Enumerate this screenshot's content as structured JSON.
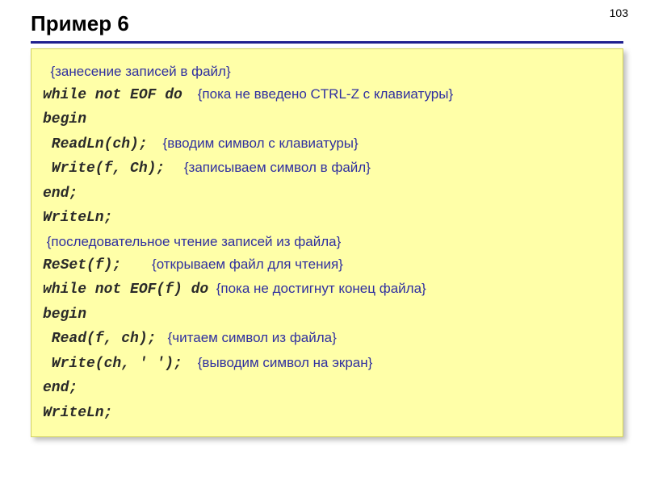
{
  "page_number": "103",
  "title": "Пример 6",
  "lines": [
    {
      "comment": "{занесение записей в файл}"
    },
    {
      "code": "while not EOF do",
      "comment": "{пока не введено CTRL-Z с клавиатуры}"
    },
    {
      "code": "begin"
    },
    {
      "code": " ReadLn(ch);",
      "comment": "{вводим символ с клавиатуры}"
    },
    {
      "code": " Write(f, Ch);",
      "comment": "{записываем символ в файл}"
    },
    {
      "code": "end;"
    },
    {
      "code": "WriteLn;"
    },
    {
      "comment": "{последовательное чтение записей из файла}"
    },
    {
      "code": "ReSet(f);",
      "comment": "{открываем файл для чтения}"
    },
    {
      "code": "while not EOF(f) do",
      "comment": "{пока не достигнут конец файла}"
    },
    {
      "code": "begin"
    },
    {
      "code": " Read(f, ch);",
      "comment": "{читаем символ из файла}"
    },
    {
      "code": " Write(ch, ' ');",
      "comment": "{выводим символ на экран}"
    },
    {
      "code": "end;"
    },
    {
      "code": "WriteLn;"
    }
  ]
}
